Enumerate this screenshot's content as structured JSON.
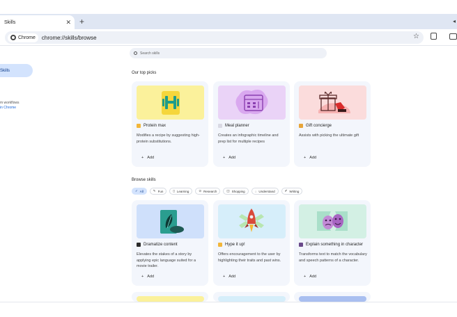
{
  "browser": {
    "tab_title": "Skills",
    "tab_close": "✕",
    "new_tab": "+",
    "chip_label": "Chrome",
    "url": "chrome://skills/browse",
    "star": "☆"
  },
  "sidebar": {
    "active_item": "Skills",
    "note": "m workflows",
    "link": "in Chrome"
  },
  "search": {
    "placeholder": "Search skills"
  },
  "top_picks": {
    "title": "Our top picks",
    "cards": [
      {
        "title": "Protein max",
        "desc": "Modifies a recipe by suggesting high-protein substitutions.",
        "add": "Add"
      },
      {
        "title": "Meal planner",
        "desc": "Creates an infographic timeline and prep list for multiple recipes",
        "add": "Add"
      },
      {
        "title": "Gift concierge",
        "desc": "Assists with picking the ultimate gift",
        "add": "Add"
      }
    ]
  },
  "browse": {
    "title": "Browse skills",
    "chips": [
      "All",
      "Fun",
      "Learning",
      "Research",
      "Shopping",
      "Understand",
      "Writing"
    ],
    "cards": [
      {
        "title": "Dramatize content",
        "desc": "Elevates the stakes of a story by applying epic language suited for a movie trailer.",
        "add": "Add"
      },
      {
        "title": "Hype it up!",
        "desc": "Offers encouragement to the user by highlighting their traits and past wins.",
        "add": "Add"
      },
      {
        "title": "Explain something in character",
        "desc": "Transforms text to match the vocabulary and speech patterns of a character.",
        "add": "Add"
      }
    ]
  },
  "colors": {
    "accent": "#d3e3fd",
    "card_bg": "#f3f6fc",
    "tabstrip": "#dfe6f3"
  }
}
